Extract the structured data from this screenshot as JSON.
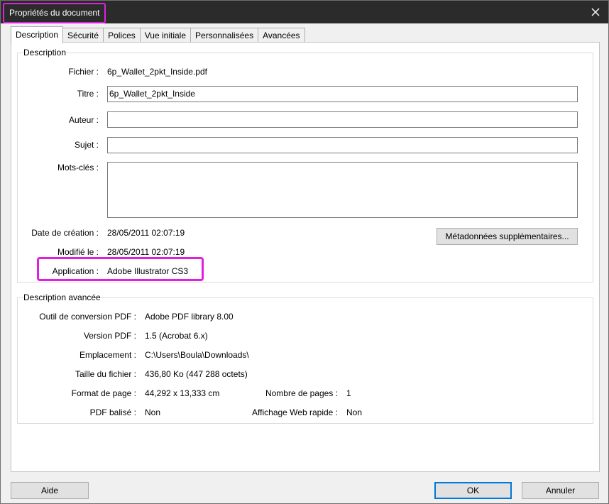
{
  "window": {
    "title": "Propriétés du document",
    "close_icon": "close-icon"
  },
  "tabs": [
    {
      "label": "Description",
      "active": true
    },
    {
      "label": "Sécurité"
    },
    {
      "label": "Polices"
    },
    {
      "label": "Vue initiale"
    },
    {
      "label": "Personnalisées"
    },
    {
      "label": "Avancées"
    }
  ],
  "description": {
    "legend": "Description",
    "file_label": "Fichier :",
    "file_value": "6p_Wallet_2pkt_Inside.pdf",
    "title_label": "Titre :",
    "title_value": "6p_Wallet_2pkt_Inside",
    "author_label": "Auteur :",
    "author_value": "",
    "subject_label": "Sujet :",
    "subject_value": "",
    "keywords_label": "Mots-clés :",
    "keywords_value": "",
    "created_label": "Date de création :",
    "created_value": "28/05/2011 02:07:19",
    "modified_label": "Modifié le :",
    "modified_value": "28/05/2011 02:07:19",
    "application_label": "Application :",
    "application_value": "Adobe Illustrator CS3",
    "metadata_button": "Métadonnées supplémentaires..."
  },
  "advanced": {
    "legend": "Description avancée",
    "producer_label": "Outil de conversion PDF :",
    "producer_value": "Adobe PDF library 8.00",
    "version_label": "Version PDF :",
    "version_value": "1.5 (Acrobat 6.x)",
    "location_label": "Emplacement :",
    "location_value": "C:\\Users\\Boula\\Downloads\\",
    "size_label": "Taille du fichier :",
    "size_value": "436,80 Ko (447 288 octets)",
    "page_format_label": "Format de page :",
    "page_format_value": "44,292 x 13,333 cm",
    "page_count_label": "Nombre de pages :",
    "page_count_value": "1",
    "tagged_label": "PDF balisé :",
    "tagged_value": "Non",
    "fast_web_label": "Affichage Web rapide :",
    "fast_web_value": "Non"
  },
  "footer": {
    "help_button": "Aide",
    "ok_button": "OK",
    "cancel_button": "Annuler"
  },
  "colors": {
    "highlight": "#e11fe0",
    "titlebar": "#2b2b2b",
    "default_button_border": "#0078d7"
  }
}
